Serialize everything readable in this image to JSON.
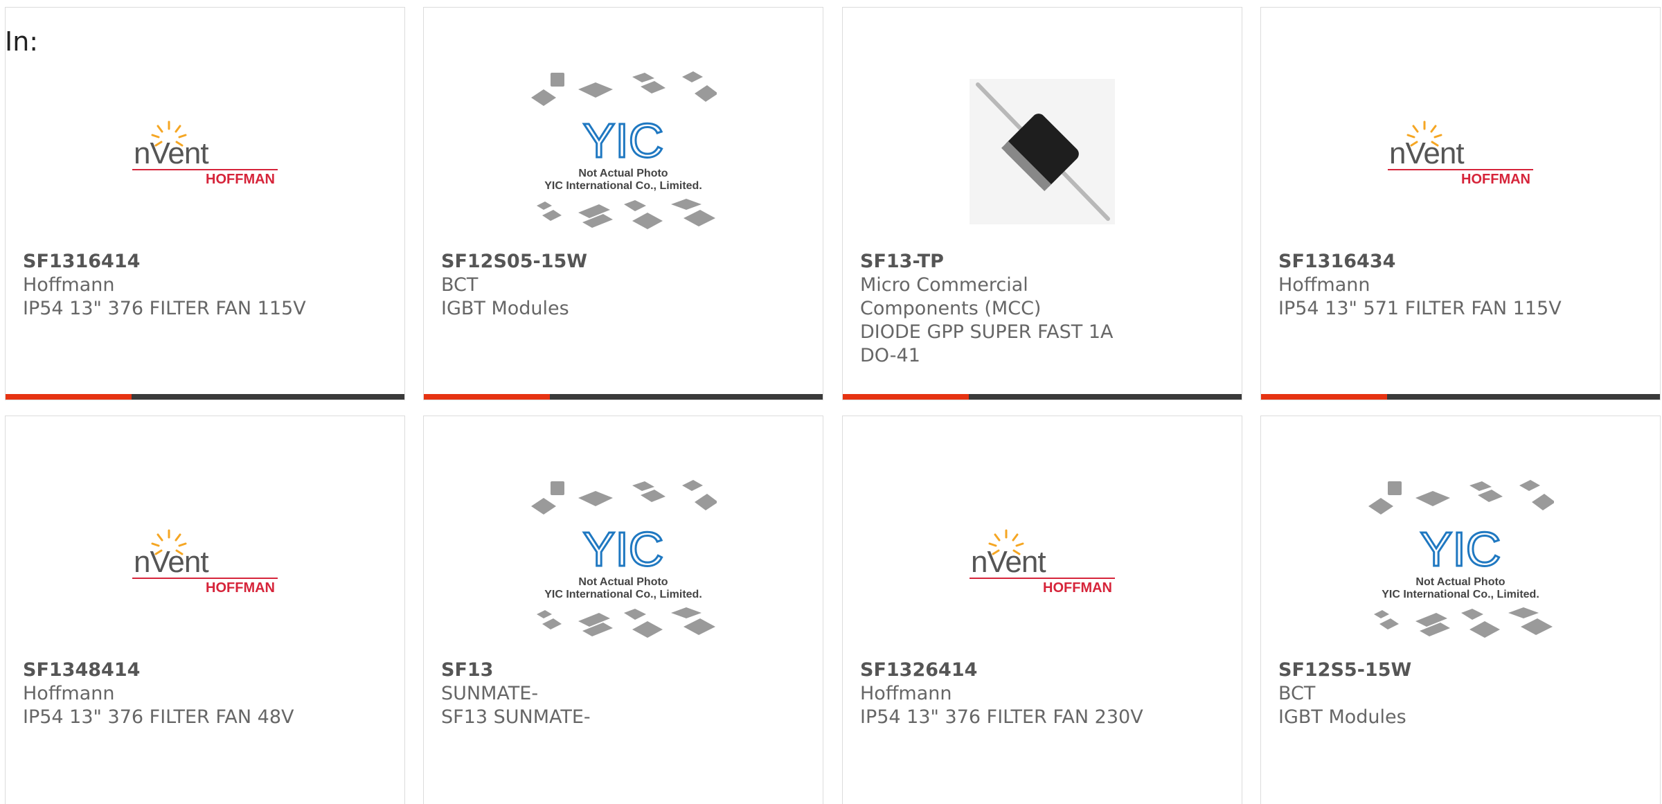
{
  "filter_label": "In:",
  "products": [
    {
      "part": "SF1316414",
      "mfr": "Hoffmann",
      "desc": "IP54 13\" 376 FILTER FAN 115V",
      "image": "nvent-hoffman-logo"
    },
    {
      "part": "SF12S05-15W",
      "mfr": "BCT",
      "desc": "IGBT Modules",
      "image": "yic-placeholder"
    },
    {
      "part": "SF13-TP",
      "mfr": "Micro Commercial Components (MCC)",
      "desc": "DIODE GPP SUPER FAST 1A DO-41",
      "image": "diode-photo"
    },
    {
      "part": "SF1316434",
      "mfr": "Hoffmann",
      "desc": "IP54 13\" 571 FILTER FAN 115V",
      "image": "nvent-hoffman-logo"
    },
    {
      "part": "SF1348414",
      "mfr": "Hoffmann",
      "desc": "IP54 13\" 376 FILTER FAN 48V",
      "image": "nvent-hoffman-logo"
    },
    {
      "part": "SF13",
      "mfr": "SUNMATE-",
      "desc": "SF13 SUNMATE-",
      "image": "yic-placeholder"
    },
    {
      "part": "SF1326414",
      "mfr": "Hoffmann",
      "desc": "IP54 13\" 376 FILTER FAN 230V",
      "image": "nvent-hoffman-logo"
    },
    {
      "part": "SF12S5-15W",
      "mfr": "BCT",
      "desc": "IGBT Modules",
      "image": "yic-placeholder"
    }
  ],
  "logos": {
    "nvent": "nVent",
    "hoffman": "HOFFMAN"
  },
  "placeholder": {
    "line1": "Not Actual Photo",
    "line2": "YIC International Co., Limited.",
    "mark": "YIC"
  },
  "colors": {
    "accent": "#e63312",
    "bar": "#3a3a3a",
    "nvent_red": "#d6243a",
    "yic_blue": "#1f78c1"
  }
}
